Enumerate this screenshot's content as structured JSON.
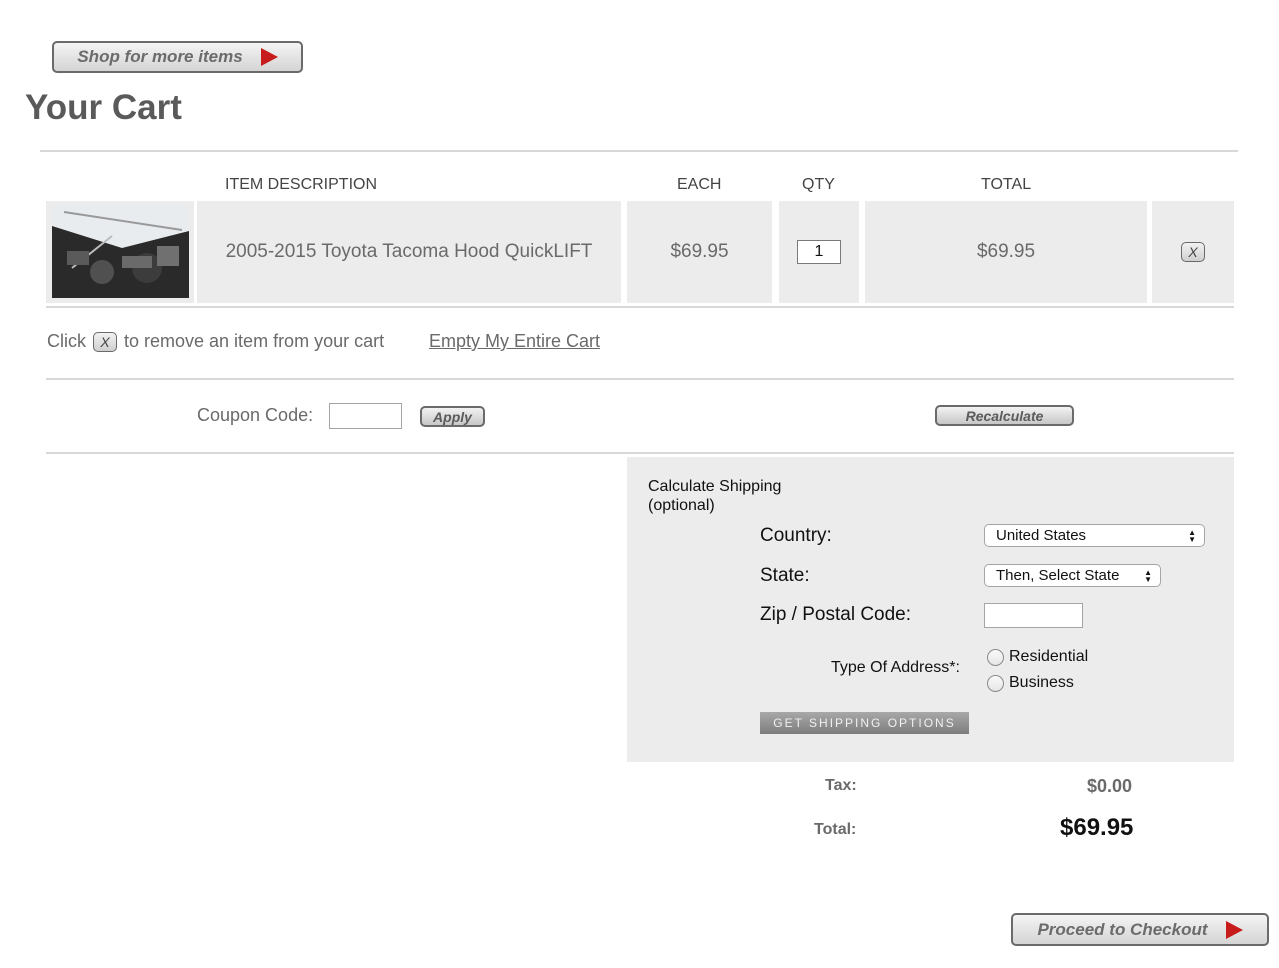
{
  "top": {
    "shop_more_label": "Shop for more items",
    "title": "Your Cart"
  },
  "table": {
    "headers": {
      "description": "ITEM  DESCRIPTION",
      "each": "EACH",
      "qty": "QTY",
      "total": "TOTAL"
    },
    "rows": [
      {
        "description": "2005-2015 Toyota Tacoma Hood QuickLIFT",
        "each": "$69.95",
        "qty": "1",
        "total": "$69.95",
        "remove_label": "X"
      }
    ]
  },
  "remove_hint": {
    "prefix": "Click",
    "icon_label": "X",
    "suffix": "to remove an item from your cart",
    "empty_link": "Empty My Entire Cart"
  },
  "coupon": {
    "label": "Coupon Code:",
    "value": "",
    "apply_label": "Apply",
    "recalculate_label": "Recalculate"
  },
  "shipping": {
    "title_line1": "Calculate Shipping",
    "title_line2": "(optional)",
    "country_label": "Country:",
    "country_value": "United States",
    "state_label": "State:",
    "state_value": "Then, Select State",
    "zip_label": "Zip / Postal Code:",
    "zip_value": "",
    "address_type_label": "Type Of Address*:",
    "address_options": [
      "Residential",
      "Business"
    ],
    "get_options_label": "GET SHIPPING OPTIONS"
  },
  "summary": {
    "tax_label": "Tax:",
    "tax_value": "$0.00",
    "total_label": "Total:",
    "total_value": "$69.95"
  },
  "checkout_label": "Proceed to Checkout"
}
